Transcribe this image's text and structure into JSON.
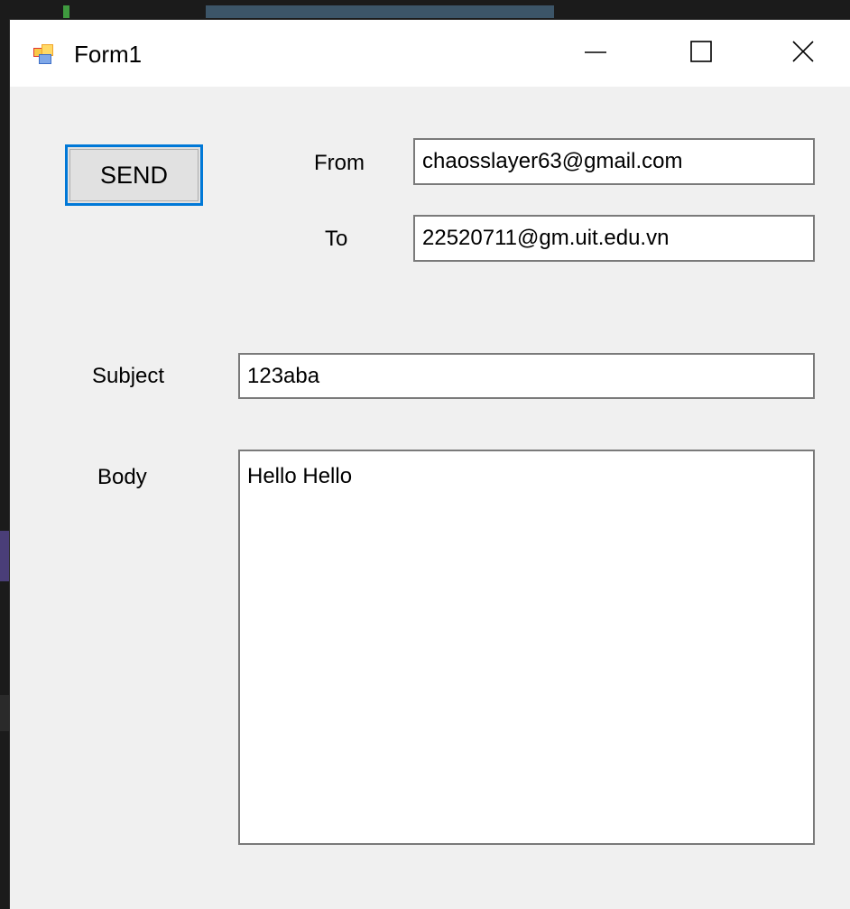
{
  "window": {
    "title": "Form1",
    "controls": {
      "minimize": "minimize-icon",
      "maximize": "maximize-icon",
      "close": "close-icon"
    }
  },
  "form": {
    "send_label": "SEND",
    "from_label": "From",
    "from_value": "chaosslayer63@gmail.com",
    "to_label": "To",
    "to_value": "22520711@gm.uit.edu.vn",
    "subject_label": "Subject",
    "subject_value": "123aba",
    "body_label": "Body",
    "body_value": "Hello Hello"
  },
  "colors": {
    "focus_border": "#0078d7",
    "window_bg": "#f0f0f0",
    "titlebar_bg": "#ffffff"
  }
}
